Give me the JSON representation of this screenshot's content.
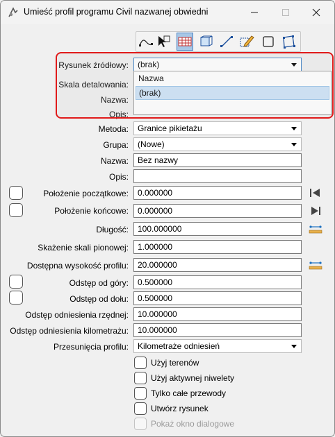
{
  "window": {
    "title": "Umieść profil programu Civil nazwanej obwiedni"
  },
  "toolbar": {
    "icons": [
      "profile-curve-icon",
      "select-arrow-icon",
      "grid-table-icon",
      "cube-view-icon",
      "line-segment-icon",
      "pencil-icon",
      "square-icon",
      "rotated-square-icon"
    ],
    "active_index": 2
  },
  "source_drawing": {
    "label": "Rysunek źródłowy:",
    "value": "(brak)",
    "options": [
      "Nazwa",
      "(brak)"
    ],
    "selected_option": "(brak)"
  },
  "hidden_rows": {
    "scale_label": "Skala detalowania:",
    "name_label": "Nazwa:",
    "desc_label": "Opis:"
  },
  "form": {
    "method_label": "Metoda:",
    "method_value": "Granice pikietażu",
    "group_label": "Grupa:",
    "group_value": "(Nowe)",
    "name_label": "Nazwa:",
    "name_value": "Bez nazwy",
    "desc_label": "Opis:",
    "desc_value": "",
    "start_label": "Położenie początkowe:",
    "start_value": "0.000000",
    "end_label": "Położenie końcowe:",
    "end_value": "0.000000",
    "length_label": "Długość:",
    "length_value": "100.000000",
    "vscale_label": "Skażenie skali pionowej:",
    "vscale_value": "1.000000",
    "height_label": "Dostępna wysokość profilu:",
    "height_value": "20.000000",
    "top_label": "Odstęp od góry:",
    "top_value": "0.500000",
    "bottom_label": "Odstęp od dołu:",
    "bottom_value": "0.500000",
    "ord_label": "Odstęp odniesienia rzędnej:",
    "ord_value": "10.000000",
    "km_label": "Odstęp odniesienia kilometrażu:",
    "km_value": "10.000000",
    "shift_label": "Przesunięcia profilu:",
    "shift_value": "Kilometraże odniesień"
  },
  "options": {
    "use_terrain": "Użyj terenów",
    "use_active_grade": "Użyj aktywnej niwelety",
    "whole_pipes": "Tylko całe przewody",
    "create_drawing": "Utwórz rysunek",
    "show_dialog": "Pokaż okno dialogowe"
  }
}
